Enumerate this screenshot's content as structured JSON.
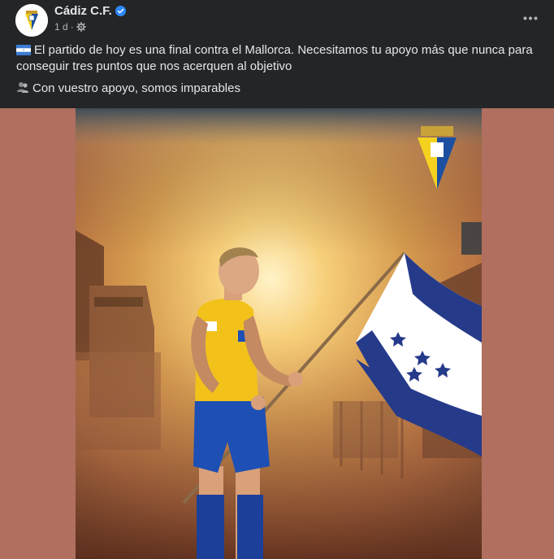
{
  "post": {
    "page_name": "Cádiz C.F.",
    "time": "1 d",
    "separator": "·",
    "text_line1": "El partido de hoy es una final contra el Mallorca. Necesitamos tu apoyo más que nunca para conseguir tres puntos que nos acerquen al objetivo",
    "text_line2": "Con vuestro apoyo, somos imparables",
    "icons": {
      "flag": "honduras-flag-emoji",
      "people": "busts-in-silhouette-emoji",
      "audience": "globe-gear-icon",
      "more": "more-options-icon",
      "verified": "verified-badge-icon"
    }
  },
  "colors": {
    "background": "#242526",
    "text": "#e4e6eb",
    "secondary_text": "#b0b3b8",
    "verified_blue": "#2d88ff",
    "side_panel": "#b06f5f"
  }
}
